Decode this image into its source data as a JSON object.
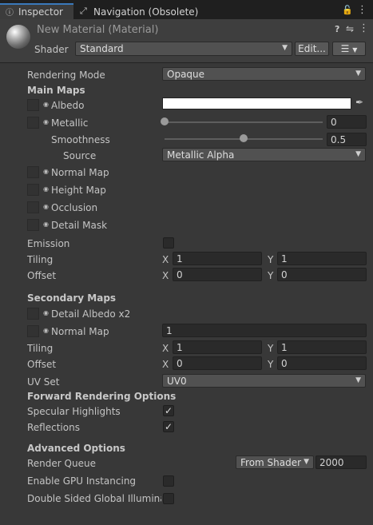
{
  "tabs": {
    "inspector": "Inspector",
    "navigation": "Navigation (Obsolete)"
  },
  "header": {
    "material_name": "New Material (Material)",
    "shader_label": "Shader",
    "shader_value": "Standard",
    "edit_label": "Edit..."
  },
  "rendering_mode": {
    "label": "Rendering Mode",
    "value": "Opaque"
  },
  "main_maps": {
    "title": "Main Maps",
    "albedo": "Albedo",
    "metallic": "Metallic",
    "metallic_value": "0",
    "metallic_fraction": 0,
    "smoothness": "Smoothness",
    "smoothness_value": "0.5",
    "smoothness_fraction": 0.5,
    "source": "Source",
    "source_value": "Metallic Alpha",
    "normal_map": "Normal Map",
    "height_map": "Height Map",
    "occlusion": "Occlusion",
    "detail_mask": "Detail Mask",
    "emission": "Emission",
    "tiling": "Tiling",
    "tiling_x": "1",
    "tiling_y": "1",
    "offset": "Offset",
    "offset_x": "0",
    "offset_y": "0"
  },
  "secondary_maps": {
    "title": "Secondary Maps",
    "detail_albedo": "Detail Albedo x2",
    "normal_map": "Normal Map",
    "normal_value": "1",
    "tiling": "Tiling",
    "tiling_x": "1",
    "tiling_y": "1",
    "offset": "Offset",
    "offset_x": "0",
    "offset_y": "0",
    "uv_set": "UV Set",
    "uv_value": "UV0"
  },
  "forward": {
    "title": "Forward Rendering Options",
    "specular": "Specular Highlights",
    "reflections": "Reflections"
  },
  "advanced": {
    "title": "Advanced Options",
    "render_queue": "Render Queue",
    "queue_mode": "From Shader",
    "queue_value": "2000",
    "gpu_instancing": "Enable GPU Instancing",
    "double_sided": "Double Sided Global Illuminati"
  },
  "axis": {
    "x": "X",
    "y": "Y"
  },
  "colors": {
    "albedo": "#ffffff",
    "accent": "#3a79bb"
  }
}
